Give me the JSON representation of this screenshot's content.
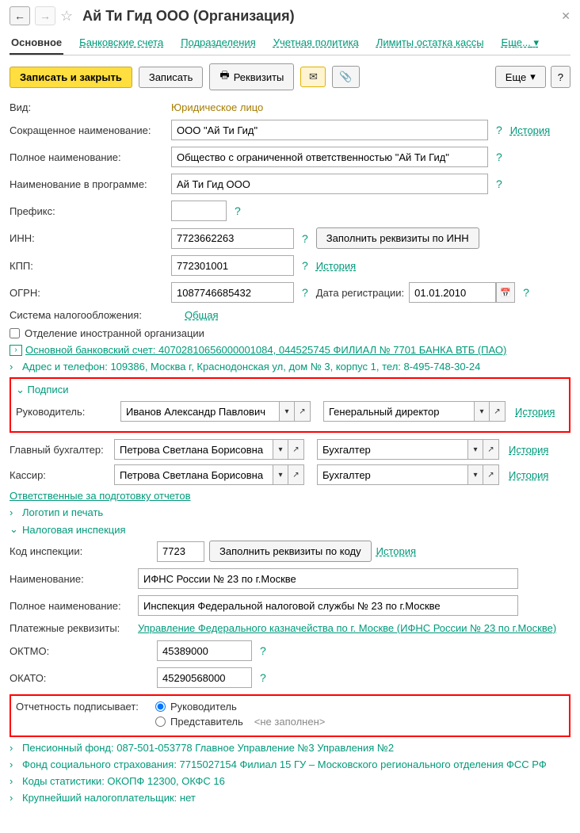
{
  "header": {
    "title": "Ай Ти Гид ООО (Организация)"
  },
  "tabs": {
    "main": "Основное",
    "bank": "Банковские счета",
    "dept": "Подразделения",
    "policy": "Учетная политика",
    "limits": "Лимиты остатка кассы",
    "more": "Еще..."
  },
  "toolbar": {
    "save_close": "Записать и закрыть",
    "save": "Записать",
    "requisites": "Реквизиты",
    "more": "Еще",
    "help": "?"
  },
  "form": {
    "vid_label": "Вид:",
    "vid_value": "Юридическое лицо",
    "short_label": "Сокращенное наименование:",
    "short_value": "ООО \"Ай Ти Гид\"",
    "full_label": "Полное наименование:",
    "full_value": "Общество с ограниченной ответственностью \"Ай Ти Гид\"",
    "prog_label": "Наименование в программе:",
    "prog_value": "Ай Ти Гид ООО",
    "prefix_label": "Префикс:",
    "prefix_value": "",
    "inn_label": "ИНН:",
    "inn_value": "7723662263",
    "inn_btn": "Заполнить реквизиты по ИНН",
    "kpp_label": "КПП:",
    "kpp_value": "772301001",
    "ogrn_label": "ОГРН:",
    "ogrn_value": "1087746685432",
    "datereg_label": "Дата регистрации:",
    "datereg_value": "01.01.2010",
    "tax_label": "Система налогообложения:",
    "tax_value": "Общая",
    "foreign_label": "Отделение иностранной организации",
    "bank_main": "Основной банковский счет: 40702810656000001084, 044525745 ФИЛИАЛ № 7701 БАНКА ВТБ (ПАО)",
    "address": "Адрес и телефон: 109386, Москва г, Краснодонская ул, дом № 3, корпус 1, тел: 8-495-748-30-24",
    "history": "История"
  },
  "signatures": {
    "header": "Подписи",
    "ruk_label": "Руководитель:",
    "ruk_name": "Иванов Александр Павлович",
    "ruk_pos": "Генеральный директор",
    "buh_label": "Главный бухгалтер:",
    "buh_name": "Петрова Светлана Борисовна",
    "buh_pos": "Бухгалтер",
    "kas_label": "Кассир:",
    "kas_name": "Петрова Светлана Борисовна",
    "kas_pos": "Бухгалтер",
    "history": "История"
  },
  "responsible": "Ответственные за подготовку отчетов",
  "logo": "Логотип и печать",
  "tax_insp": {
    "header": "Налоговая инспекция",
    "code_label": "Код инспекции:",
    "code_value": "7723",
    "code_btn": "Заполнить реквизиты по коду",
    "history": "История",
    "name_label": "Наименование:",
    "name_value": "ИФНС России № 23 по г.Москве",
    "full_label": "Полное наименование:",
    "full_value": "Инспекция Федеральной налоговой службы № 23 по г.Москве",
    "pay_label": "Платежные реквизиты:",
    "pay_value": "Управление Федерального казначейства по г. Москве (ИФНС России № 23 по г.Москве)",
    "oktmo_label": "ОКТМО:",
    "oktmo_value": "45389000",
    "okato_label": "ОКАТО:",
    "okato_value": "45290568000",
    "signed_label": "Отчетность подписывает:",
    "signed_ruk": "Руководитель",
    "signed_rep": "Представитель",
    "not_filled": "<не заполнен>"
  },
  "footer": {
    "pension": "Пенсионный фонд: 087-501-053778 Главное Управление №3 Управления №2",
    "fss": "Фонд социального страхования: 7715027154 Филиал 15 ГУ – Московского регионального отделения ФСС РФ",
    "stats": "Коды статистики: ОКОПФ 12300, ОКФС 16",
    "biggest": "Крупнейший налогоплательщик: нет"
  }
}
